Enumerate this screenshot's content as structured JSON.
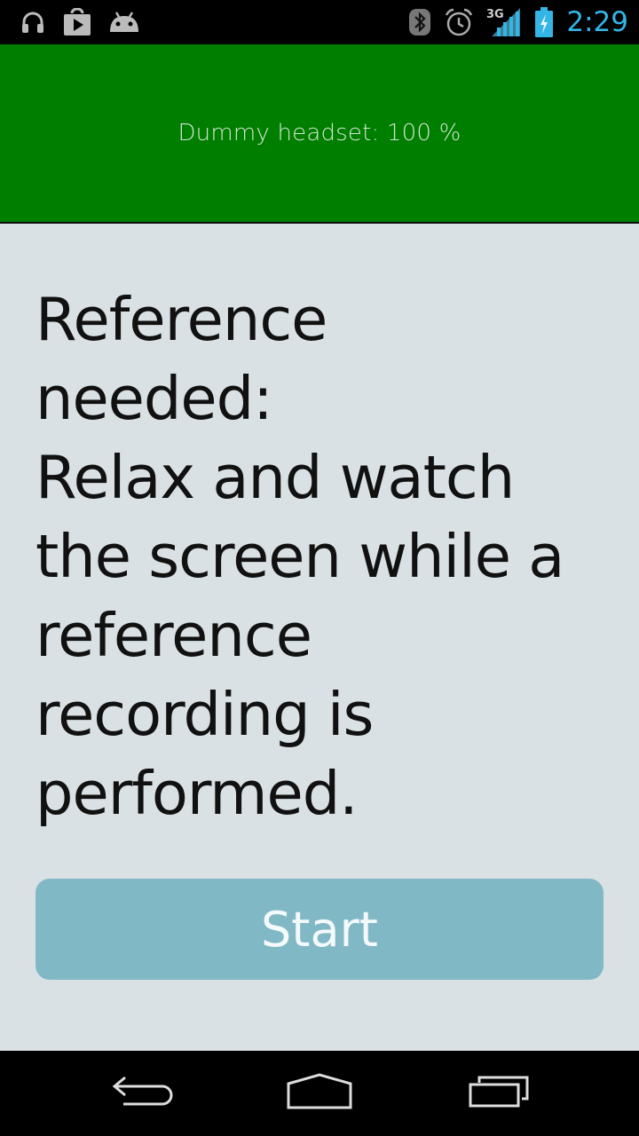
{
  "status_bar": {
    "time": "2:29",
    "network_label": "3G",
    "left_icons": [
      "headphones-icon",
      "play-store-icon",
      "android-icon"
    ],
    "right_icons": [
      "bluetooth-icon",
      "alarm-icon",
      "signal-icon",
      "battery-charging-icon"
    ],
    "accent_color": "#33b5e5"
  },
  "banner": {
    "text": "Dummy headset: 100 %",
    "background_color": "#007e00"
  },
  "instruction": {
    "text": "Reference\nneeded:\nRelax and watch\nthe screen while a\nreference\nrecording is\nperformed."
  },
  "start_button": {
    "label": "Start",
    "color": "#80b9c5"
  },
  "nav_bar": {
    "buttons": [
      "back-icon",
      "home-icon",
      "recent-apps-icon"
    ]
  }
}
